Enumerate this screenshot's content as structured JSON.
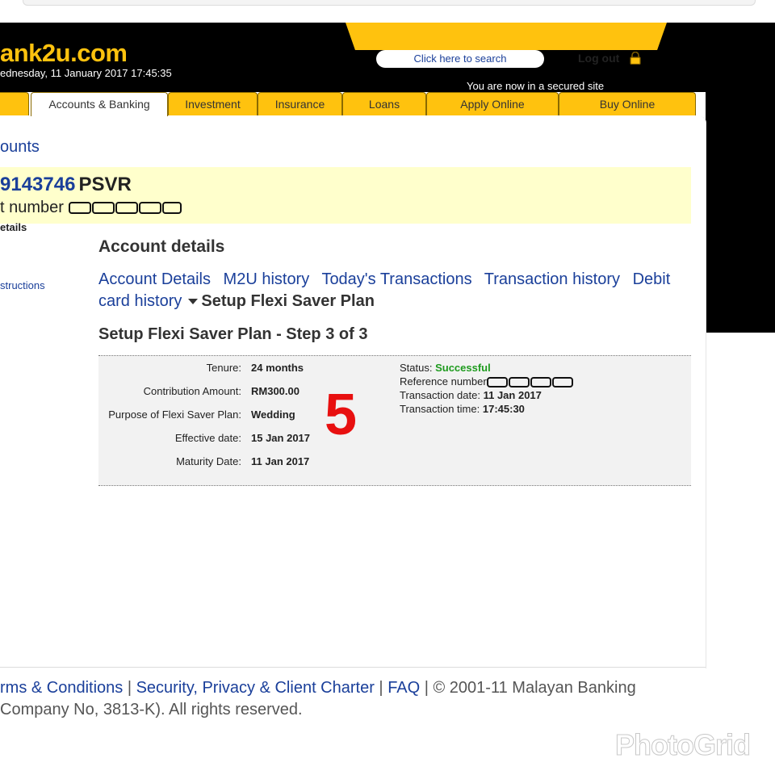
{
  "header": {
    "logo_text": "ank2u.com",
    "datetime": "ednesday, 11 January 2017 17:45:35",
    "search_label": "Click here to search",
    "logout_label": "Log out",
    "secured_text": "You are now in a secured site"
  },
  "nav": {
    "tabs": [
      "Accounts & Banking",
      "Investment",
      "Insurance",
      "Loans",
      "Apply Online",
      "Buy Online"
    ]
  },
  "breadcrumb": "ounts",
  "account": {
    "number_partial": "9143746",
    "type": "PSVR",
    "label": "t number"
  },
  "side": {
    "details": "etails",
    "instructions": "structions"
  },
  "section_title": "Account details",
  "subnav": {
    "links": [
      "Account Details",
      "M2U history",
      "Today's Transactions",
      "Transaction history",
      "Debit card history"
    ],
    "current": "Setup Flexi Saver Plan"
  },
  "step_title": "Setup Flexi Saver Plan - Step 3 of 3",
  "details": {
    "left": [
      {
        "label": "Tenure:",
        "value": "24 months"
      },
      {
        "label": "Contribution Amount:",
        "value": "RM300.00"
      },
      {
        "label": "Purpose of Flexi Saver Plan:",
        "value": "Wedding"
      },
      {
        "label": "Effective date:",
        "value": "15 Jan 2017"
      },
      {
        "label": "Maturity Date:",
        "value": "11 Jan 2017"
      }
    ],
    "status_label": "Status:",
    "status_value": "Successful",
    "reference_label": "Reference number",
    "txn_date_label": "Transaction date:",
    "txn_date_value": "11 Jan 2017",
    "txn_time_label": "Transaction time:",
    "txn_time_value": "17:45:30"
  },
  "annotation": "5",
  "footer": {
    "terms": "rms & Conditions",
    "security": "Security, Privacy & Client Charter",
    "faq": "FAQ",
    "copyright": "© 2001-11 Malayan Banking",
    "company": "Company No, 3813-K). All rights reserved."
  },
  "watermark": "PhotoGrid",
  "colors": {
    "brand_yellow": "#ffc20e",
    "link_blue": "#1a3f9a",
    "success_green": "#1e9b1e",
    "annotation_red": "#e81010"
  }
}
